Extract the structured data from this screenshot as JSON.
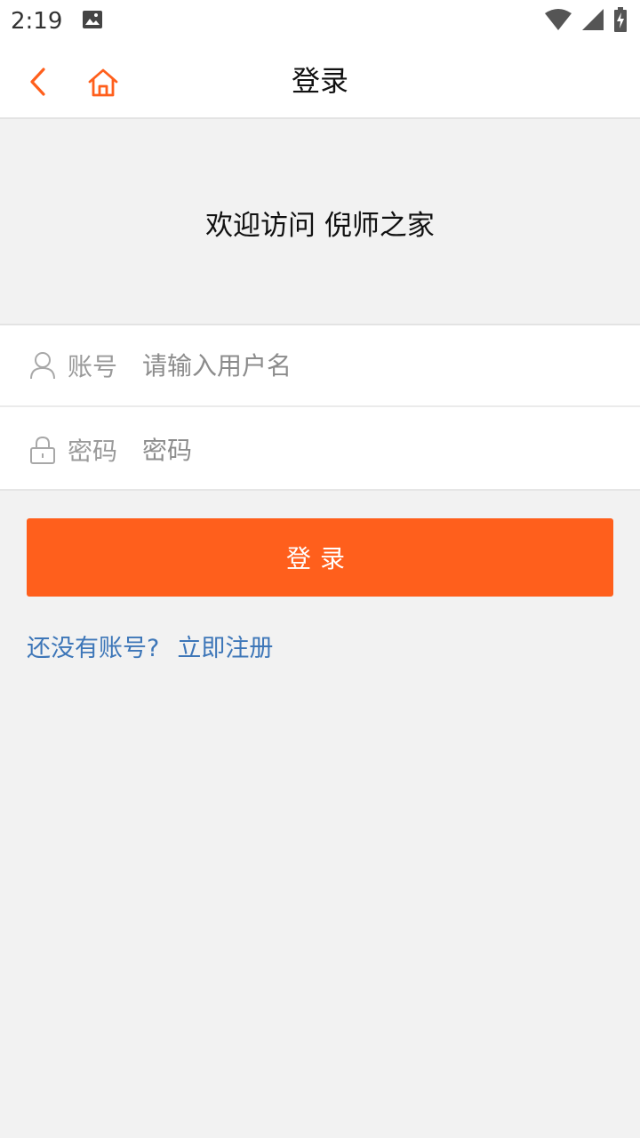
{
  "status_bar": {
    "time": "2:19",
    "icons": [
      "image-icon",
      "wifi-icon",
      "signal-icon",
      "battery-charging-icon"
    ]
  },
  "nav": {
    "title": "登录",
    "back_icon": "chevron-left-icon",
    "home_icon": "home-icon",
    "accent_color": "#ff5f1c"
  },
  "welcome": {
    "text": "欢迎访问 倪师之家"
  },
  "form": {
    "username": {
      "label": "账号",
      "placeholder": "请输入用户名",
      "value": "",
      "icon": "user-icon"
    },
    "password": {
      "label": "密码",
      "placeholder": "密码",
      "value": "",
      "icon": "lock-icon"
    }
  },
  "login_button": {
    "label": "登录",
    "color": "#ff5f1c"
  },
  "register": {
    "prompt": "还没有账号?",
    "link": "立即注册",
    "color": "#3d76b8"
  }
}
